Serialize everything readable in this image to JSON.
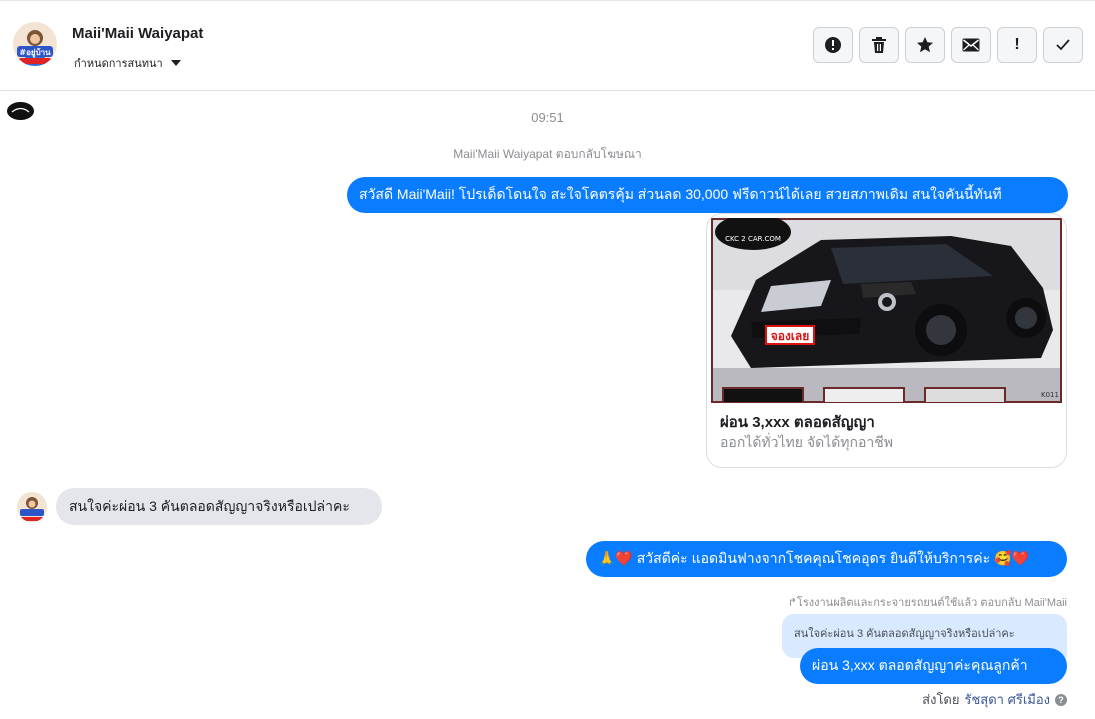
{
  "header": {
    "name": "Maii'Maii Waiyapat",
    "subtitle": "กำหนดการสนทนา",
    "avatar_text": "#อยู่บ้าน",
    "actions": [
      "alert-circle-icon",
      "trash-icon",
      "star-icon",
      "envelope-icon",
      "exclamation-icon",
      "check-icon"
    ],
    "exclamation_label": "!"
  },
  "thread": {
    "time": "09:51",
    "replied_to_ad": "Maii'Maii Waiyapat ตอบกลับโฆษณา",
    "messages": [
      {
        "from": "page",
        "text": "สวัสดี Maii'Maii! โปรเด็ดโดนใจ สะใจโคตรคุ้ม ส่วนลด 30,000 ฟรีดาวน์ได้เลย สวยสภาพเดิม สนใจคันนี้ทันที"
      },
      {
        "from": "customer",
        "text": "สนใจค่ะผ่อน 3 คันตลอดสัญญาจริงหรือเปล่าคะ"
      },
      {
        "from": "page",
        "text": "🙏❤️ สวัสดีค่ะ แอดมินฟางจากโชคคุณโชคอุดร ยินดีให้บริการค่ะ 🥰❤️"
      },
      {
        "from": "page",
        "text": "ผ่อน 3,xxx ตลอดสัญญาค่ะคุณลูกค้า"
      }
    ],
    "ad_card": {
      "title": "ผ่อน 3,xxx ตลอดสัญญา",
      "subtitle": "ออกได้ทั่วไทย จัดได้ทุกอาชีพ",
      "logo_text": "CKC 2 CAR.COM",
      "badge_text": "จองเลย",
      "plate_text": "K011"
    },
    "reply_meta": "↱โรงงานผลิตและกระจายรถยนต์ใช้แล้ว ตอบกลับ Maii'Maii",
    "quoted_text": "สนใจค่ะผ่อน 3 คันตลอดสัญญาจริงหรือเปล่าคะ",
    "sent_by_prefix": "ส่งโดย",
    "sent_by_name": "รัชสุดา ศรีเมือง",
    "help_label": "?"
  },
  "colors": {
    "outgoing_bubble": "#0a7cff",
    "incoming_bubble": "#e4e6eb",
    "quoted_bubble": "#d9e9ff"
  }
}
